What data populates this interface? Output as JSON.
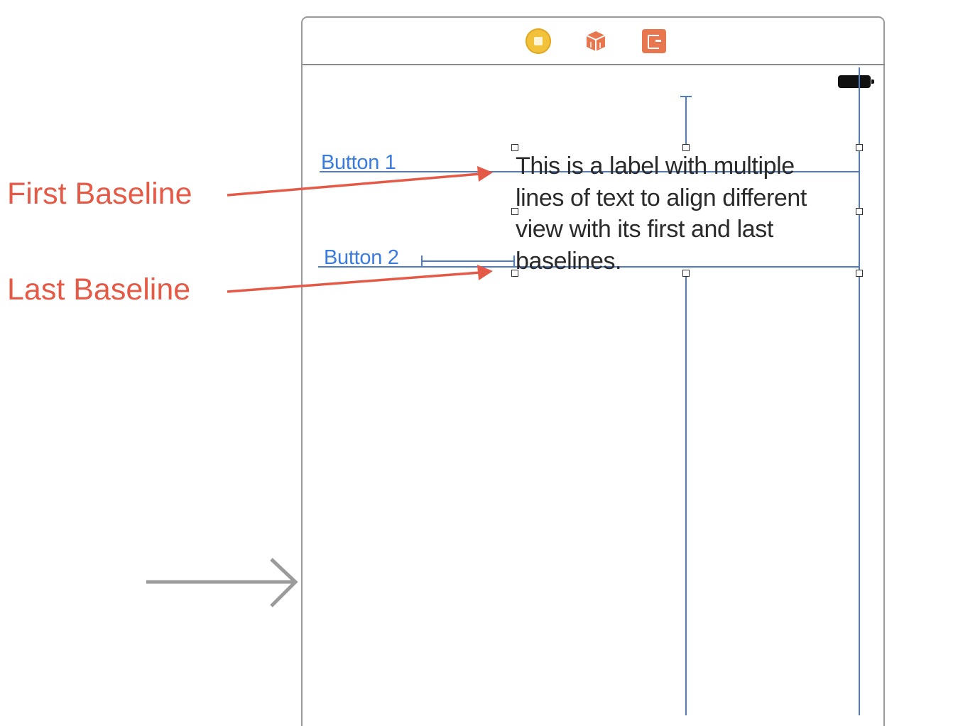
{
  "annotations": {
    "first_baseline": "First Baseline",
    "last_baseline": "Last Baseline"
  },
  "scene": {
    "dock_icons": [
      "view-controller-icon",
      "first-responder-icon",
      "exit-icon"
    ],
    "status_bar_icon": "battery-icon"
  },
  "buttons": {
    "button1": "Button 1",
    "button2": "Button 2"
  },
  "label": {
    "lines": [
      "This is a label with multiple",
      "lines of text to align different",
      "view with its first and last",
      "baselines."
    ]
  },
  "colors": {
    "annotation": "#e45a47",
    "guide": "#4f7cc7",
    "button": "#3a7be0",
    "entry_arrow": "#9b9b9b"
  }
}
